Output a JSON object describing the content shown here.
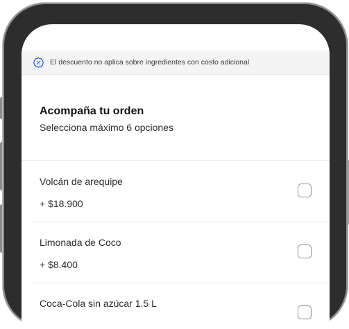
{
  "notice": {
    "icon": "discount-badge-icon",
    "text": "El descuento no aplica sobre ingredientes con costo adicional"
  },
  "section": {
    "title": "Acompaña tu orden",
    "subtitle": "Selecciona máximo 6 opciones"
  },
  "options": [
    {
      "name": "Volcán de arequipe",
      "price": "+ $18.900",
      "checked": false
    },
    {
      "name": "Limonada de Coco",
      "price": "+ $8.400",
      "checked": false
    },
    {
      "name": "Coca-Cola sin azúcar 1.5 L",
      "price": "",
      "checked": false
    }
  ],
  "colors": {
    "accent": "#3a6ff0",
    "frame": "#2d2d2d",
    "notice_bg": "#f4f4f5"
  }
}
